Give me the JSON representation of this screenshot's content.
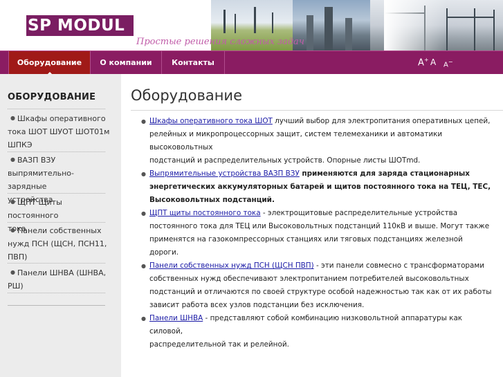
{
  "header": {
    "logo": "SP MODUL",
    "tagline": "Простые решения сложных задач"
  },
  "nav": {
    "items": [
      {
        "label": "Оборудование",
        "active": true
      },
      {
        "label": "О компании",
        "active": false
      },
      {
        "label": "Контакты",
        "active": false
      }
    ],
    "font_controls": {
      "increase": "A",
      "increase_mark": "+",
      "normal": "A",
      "decrease": "A",
      "decrease_mark": "−"
    }
  },
  "sidebar": {
    "title": "ОБОРУДОВАНИЕ",
    "items": [
      {
        "line1": "Шкафы оперативного",
        "line2": "тока ШОТ ШУОТ ШОТ01м",
        "line3": "ШПКЭ"
      },
      {
        "line1": "ВАЗП ВЗУ",
        "line2": "выпрямительно-зарядные",
        "line3": "устройства"
      },
      {
        "line1": "ЩПТ Щиты постоянного",
        "line2": "тока"
      },
      {
        "line1": "Панели собственных",
        "line2": "нужд ПСН (ЩСН, ПСН11,",
        "line3": "ПВП)"
      },
      {
        "line1": "Панели ШНВА (ШНВА,",
        "line2": "РШ)"
      }
    ]
  },
  "main": {
    "title": "Оборудование",
    "entries": [
      {
        "link": "Шкафы оперативного тока ШОТ",
        "lines": [
          " лучший выбор для электропитания оперативных цепей,",
          "релейных и микропроцессорных защит, систем телемеханики и автоматики высоковольтных",
          "подстанций и распределительных устройств. Опорные листы ШОТmd."
        ]
      },
      {
        "link": "Выпрямительные устройства ВАЗП ВЗУ",
        "lines": [
          " применяются для заряда стационарных",
          "энергетических аккумуляторных батарей и щитов постоянного тока на ТЕЦ, ТЕС,",
          "Высоковольтных подстанций."
        ]
      },
      {
        "link": "ЩПТ щиты постоянного тока",
        "lines": [
          " - электрощитовые распределительные устройства",
          "постоянного тока для ТЕЦ или Высоковольтных подстанций 110кВ и выше. Могут также",
          "применятся на газокомпрессорных станциях или тяговых подстанциях железной дороги."
        ]
      },
      {
        "link": "Панели собственных нужд ПСН (ЩСН ПВП)",
        "lines": [
          " - эти панели совмесно с трансформаторами",
          "собственных нужд обеспечивают электропитанием потребителей высоковольтных",
          "подстанций и отличаются по своей структуре особой надежностью так как от их работы",
          "зависит работа всех узлов подстанции без исключения."
        ]
      },
      {
        "link": "Панели ШНВА",
        "lines": [
          " - представляют собой комбинацию низковольтной аппаратуры как силовой,",
          "распределительной так и релейной."
        ]
      }
    ]
  }
}
